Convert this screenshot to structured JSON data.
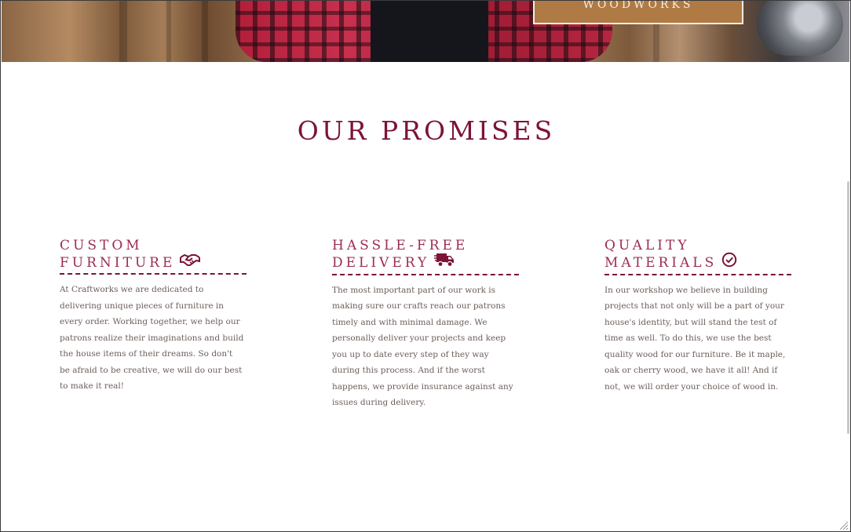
{
  "hero": {
    "brand_text": "WOODWORKS"
  },
  "promises": {
    "title": "OUR PROMISES",
    "cards": [
      {
        "title_line1": "CUSTOM",
        "title_line2": "FURNITURE",
        "icon": "handshake-icon",
        "body": "At Craftworks we are dedicated to delivering unique pieces of furniture in every order. Working together, we help our patrons realize their imaginations and build the house items of their dreams. So don't be afraid to be creative, we will do our best to make it real!"
      },
      {
        "title_line1": "HASSLE-FREE",
        "title_line2": "DELIVERY",
        "icon": "delivery-truck-icon",
        "body": "The most important part of our work is making sure our crafts reach our patrons timely and with minimal damage. We personally deliver your projects and keep you up to date every step of they way during this process. And if the worst happens, we provide insurance against any issues during delivery."
      },
      {
        "title_line1": "QUALITY",
        "title_line2": "MATERIALS",
        "icon": "check-circle-icon",
        "body": "In our workshop we believe in building projects that not only will be a part of your house's identity, but will stand the test of time as well. To do this, we use the best quality wood for our furniture. Be it maple, oak or cherry wood, we have it all! And if not, we will order your choice of wood in."
      }
    ]
  },
  "colors": {
    "accent": "#7b1436",
    "heading": "#9b2b55",
    "body_text": "#6b5e5a",
    "brand_box": "#b07a45"
  }
}
